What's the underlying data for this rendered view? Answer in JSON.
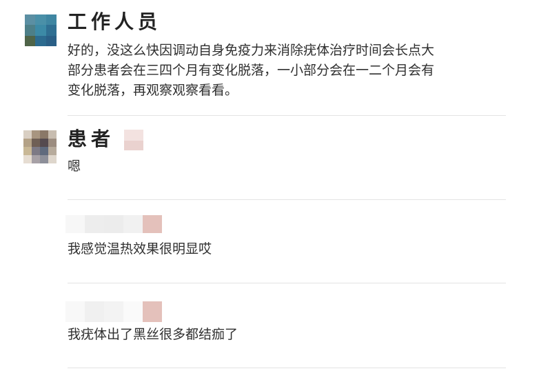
{
  "messages": [
    {
      "sender": "工作人员",
      "text_lines": [
        "好的，没这么快因调动自身免疫力来消除疣体治疗时间会长点大",
        "部分患者会在三四个月有变化脱落，一小部分会在一二个月会有",
        "变化脱落，再观察观察看看。"
      ]
    },
    {
      "sender": "患者",
      "text_lines": [
        "嗯"
      ]
    },
    {
      "sender": "",
      "text_lines": [
        "我感觉温热效果很明显哎"
      ]
    },
    {
      "sender": "",
      "text_lines": [
        "我疣体出了黑丝很多都结痂了"
      ]
    }
  ],
  "colors": {
    "divider": "#e3e3e3",
    "text": "#2f2f2f",
    "blur_accent": "#e4c1bb"
  }
}
